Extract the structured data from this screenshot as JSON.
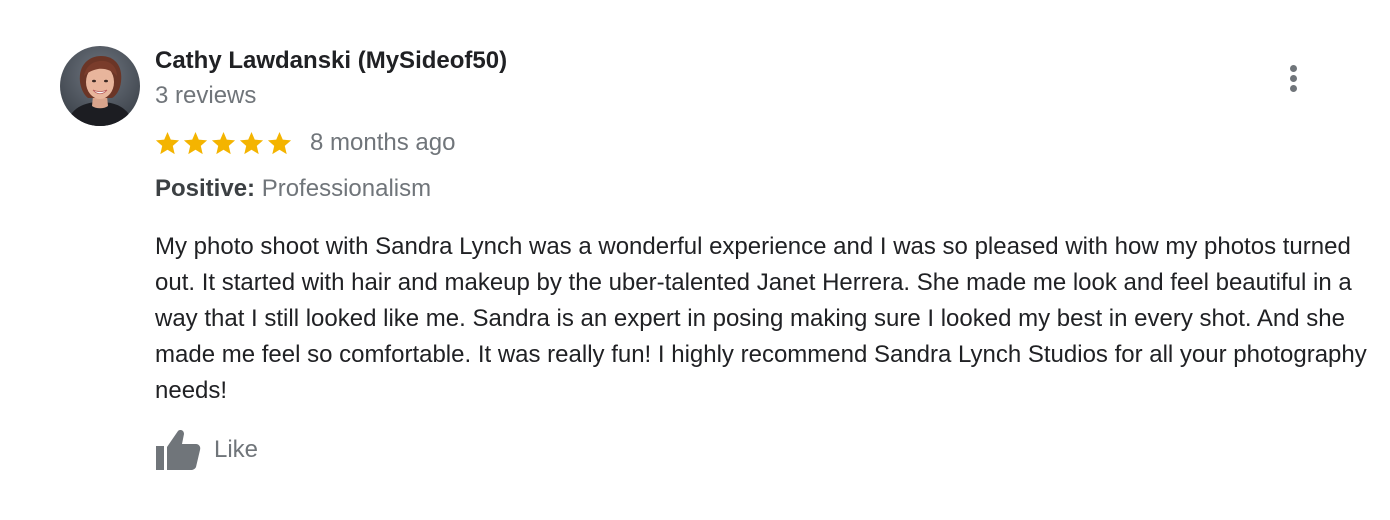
{
  "reviewer": {
    "name": "Cathy Lawdanski (MySideof50)",
    "review_count": "3 reviews",
    "avatar_icon": "profile-photo-avatar"
  },
  "review": {
    "rating": 5,
    "max_rating": 5,
    "time_ago": "8 months ago",
    "highlight": {
      "label": "Positive:",
      "value": "Professionalism"
    },
    "text": "My photo shoot with Sandra Lynch was a wonderful experience and I was so pleased with how my photos turned out. It started with hair and makeup by the uber-talented Janet Herrera. She made me look and feel beautiful in a way that I still looked like me. Sandra is an expert in posing making sure I looked my best in every shot. And she made me feel so comfortable. It was really fun! I highly recommend Sandra Lynch Studios for all your photography needs!"
  },
  "actions": {
    "like_label": "Like",
    "like_icon": "thumbs-up-icon",
    "more_icon": "more-vertical-icon"
  },
  "colors": {
    "star": "#f4b400",
    "name": "#202124",
    "secondary_text": "#70757a",
    "body_text": "#202124"
  }
}
